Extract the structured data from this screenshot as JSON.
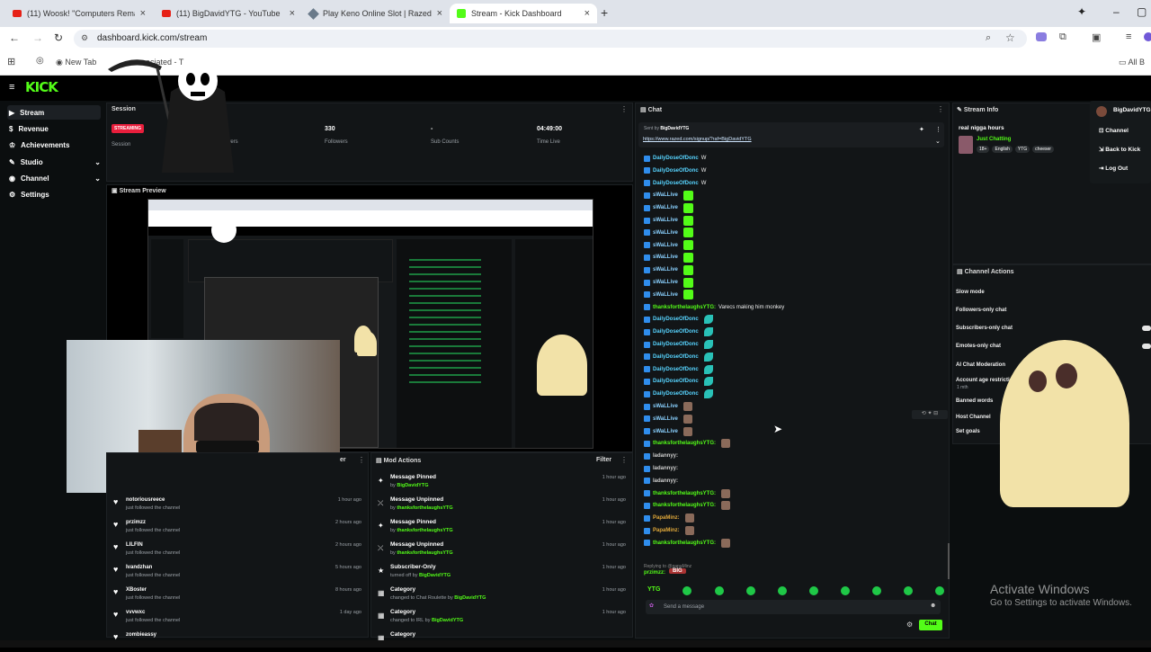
{
  "browser": {
    "tabs": [
      {
        "title": "(11) Woosk! \"Computers Rema",
        "icon": "youtube-icon"
      },
      {
        "title": "(11) BigDavidYTG - YouTube",
        "icon": "youtube-icon"
      },
      {
        "title": "Play Keno Online Slot | Razed C",
        "icon": "razed-icon"
      },
      {
        "title": "Stream - Kick Dashboard",
        "icon": "kick-icon"
      }
    ],
    "url": "dashboard.kick.com/stream",
    "bookmarks": {
      "new_tab": "New Tab",
      "associated": "ociated - T",
      "all": "All B"
    }
  },
  "kick": {
    "logo": "KICK",
    "sidebar": [
      {
        "label": "Stream",
        "icon": "stream-icon"
      },
      {
        "label": "Revenue",
        "icon": "revenue-icon"
      },
      {
        "label": "Achievements",
        "icon": "trophy-icon"
      },
      {
        "label": "Studio",
        "icon": "studio-icon"
      },
      {
        "label": "Channel",
        "icon": "channel-icon"
      },
      {
        "label": "Settings",
        "icon": "gear-icon"
      }
    ],
    "session": {
      "title": "Session",
      "status": "STREAMING",
      "session_label": "Session",
      "stats": [
        {
          "value": "",
          "label": "wers"
        },
        {
          "value": "330",
          "label": "Followers"
        },
        {
          "value": "-",
          "label": "Sub Counts"
        },
        {
          "value": "04:49:00",
          "label": "Time Live"
        }
      ]
    },
    "preview": {
      "title": "Stream Preview"
    },
    "followers": {
      "title": "er",
      "items": [
        {
          "name": "notoriousreece",
          "sub": "just followed the channel",
          "time": "1 hour ago"
        },
        {
          "name": "przimzz",
          "sub": "just followed the channel",
          "time": "2 hours ago"
        },
        {
          "name": "LILFIN",
          "sub": "just followed the channel",
          "time": "2 hours ago"
        },
        {
          "name": "Ivandzhan",
          "sub": "just followed the channel",
          "time": "5 hours ago"
        },
        {
          "name": "XBoster",
          "sub": "just followed the channel",
          "time": "8 hours ago"
        },
        {
          "name": "vvvwxc",
          "sub": "just followed the channel",
          "time": "1 day ago"
        },
        {
          "name": "zombieassy",
          "sub": "",
          "time": ""
        }
      ]
    },
    "mod_actions": {
      "title": "Mod Actions",
      "filter": "Filter",
      "items": [
        {
          "title": "Message Pinned",
          "by": "by",
          "who": "BigDavidYTG",
          "time": "1 hour ago",
          "icon": "pin-icon"
        },
        {
          "title": "Message Unpinned",
          "by": "by",
          "who": "thanksforthelaughsYTG",
          "time": "1 hour ago",
          "icon": "unpin-icon"
        },
        {
          "title": "Message Pinned",
          "by": "by",
          "who": "thanksforthelaughsYTG",
          "time": "1 hour ago",
          "icon": "pin-icon"
        },
        {
          "title": "Message Unpinned",
          "by": "by",
          "who": "thanksforthelaughsYTG",
          "time": "1 hour ago",
          "icon": "unpin-icon"
        },
        {
          "title": "Subscriber-Only",
          "by": "turned off by",
          "who": "BigDavidYTG",
          "time": "1 hour ago",
          "icon": "subscriber-icon"
        },
        {
          "title": "Category",
          "by": "changed to Chat Roulette by",
          "who": "BigDavidYTG",
          "time": "1 hour ago",
          "icon": "category-icon"
        },
        {
          "title": "Category",
          "by": "changed to IRL by",
          "who": "BigDavidYTG",
          "time": "1 hour ago",
          "icon": "category-icon"
        },
        {
          "title": "Category",
          "by": "",
          "who": "",
          "time": "",
          "icon": "category-icon"
        }
      ]
    },
    "chat": {
      "title": "Chat",
      "pinned_by": "Sent by",
      "pinned_user": "BigDavidYTG",
      "pinned_link": "https://www.razed.com/signup/?raf=BigDavidYTG",
      "placeholder": "Send a message",
      "send": "Chat",
      "messages": [
        {
          "user": "DailyDoseOfDonc",
          "text": "W",
          "emote": ""
        },
        {
          "user": "DailyDoseOfDonc",
          "text": "W",
          "emote": ""
        },
        {
          "user": "DailyDoseOfDonc",
          "text": "W",
          "emote": ""
        },
        {
          "user": "sWaLLive",
          "text": "",
          "emote": "w"
        },
        {
          "user": "sWaLLive",
          "text": "",
          "emote": "w"
        },
        {
          "user": "sWaLLive",
          "text": "",
          "emote": "w"
        },
        {
          "user": "sWaLLive",
          "text": "",
          "emote": "w"
        },
        {
          "user": "sWaLLive",
          "text": "",
          "emote": "w"
        },
        {
          "user": "sWaLLive",
          "text": "",
          "emote": "w"
        },
        {
          "user": "sWaLLive",
          "text": "",
          "emote": "w"
        },
        {
          "user": "sWaLLive",
          "text": "",
          "emote": "w"
        },
        {
          "user": "sWaLLive",
          "text": "",
          "emote": "w"
        },
        {
          "user": "thanksforthelaughsYTG:",
          "text": "Varecs making him monkey",
          "emote": ""
        },
        {
          "user": "DailyDoseOfDonc",
          "text": "",
          "emote": "f"
        },
        {
          "user": "DailyDoseOfDonc",
          "text": "",
          "emote": "f"
        },
        {
          "user": "DailyDoseOfDonc",
          "text": "",
          "emote": "f"
        },
        {
          "user": "DailyDoseOfDonc",
          "text": "",
          "emote": "f"
        },
        {
          "user": "DailyDoseOfDonc",
          "text": "",
          "emote": "f"
        },
        {
          "user": "DailyDoseOfDonc",
          "text": "",
          "emote": "f"
        },
        {
          "user": "DailyDoseOfDonc",
          "text": "",
          "emote": "f"
        },
        {
          "user": "sWaLLive",
          "text": "",
          "emote": "p"
        },
        {
          "user": "sWaLLive",
          "text": "",
          "emote": "p"
        },
        {
          "user": "sWaLLive",
          "text": "",
          "emote": "p"
        },
        {
          "user": "thanksforthelaughsYTG:",
          "text": "",
          "emote": "p"
        },
        {
          "user": "ladannyy:",
          "text": "",
          "emote": ""
        },
        {
          "user": "ladannyy:",
          "text": "",
          "emote": ""
        },
        {
          "user": "ladannyy:",
          "text": "",
          "emote": ""
        },
        {
          "user": "thanksforthelaughsYTG:",
          "text": "",
          "emote": "p"
        },
        {
          "user": "thanksforthelaughsYTG:",
          "text": "",
          "emote": "p"
        },
        {
          "user": "PapaMinz:",
          "text": "",
          "emote": "p"
        },
        {
          "user": "PapaMinz:",
          "text": "",
          "emote": "p"
        },
        {
          "user": "thanksforthelaughsYTG:",
          "text": "",
          "emote": "p"
        }
      ],
      "replying": "Replying to @papaMinz",
      "last_user": "przimzz:",
      "last_text": "BIG"
    },
    "stream_info": {
      "title": "Stream Info",
      "stream_title": "real nigga hours",
      "category": "Just Chatting",
      "tags": [
        "18+",
        "English",
        "YTG",
        "cheeser"
      ]
    },
    "user_menu": {
      "username": "BigDavidYTG",
      "items": [
        "Channel",
        "Back to Kick",
        "Log Out"
      ]
    },
    "channel_actions": {
      "title": "Channel Actions",
      "items": [
        "Slow mode",
        "Followers-only chat",
        "Subscribers-only chat",
        "Emotes-only chat",
        "AI Chat Moderation",
        "Account age restriction",
        "Banned words",
        "Host Channel",
        "Set goals"
      ],
      "sub": "1 mth"
    },
    "watermark": {
      "title": "Activate Windows",
      "sub": "Go to Settings to activate Windows."
    },
    "colors": {
      "kick_green": "#53fc18",
      "streaming_red": "#e91e3c",
      "bg": "#0b0e0f"
    }
  }
}
